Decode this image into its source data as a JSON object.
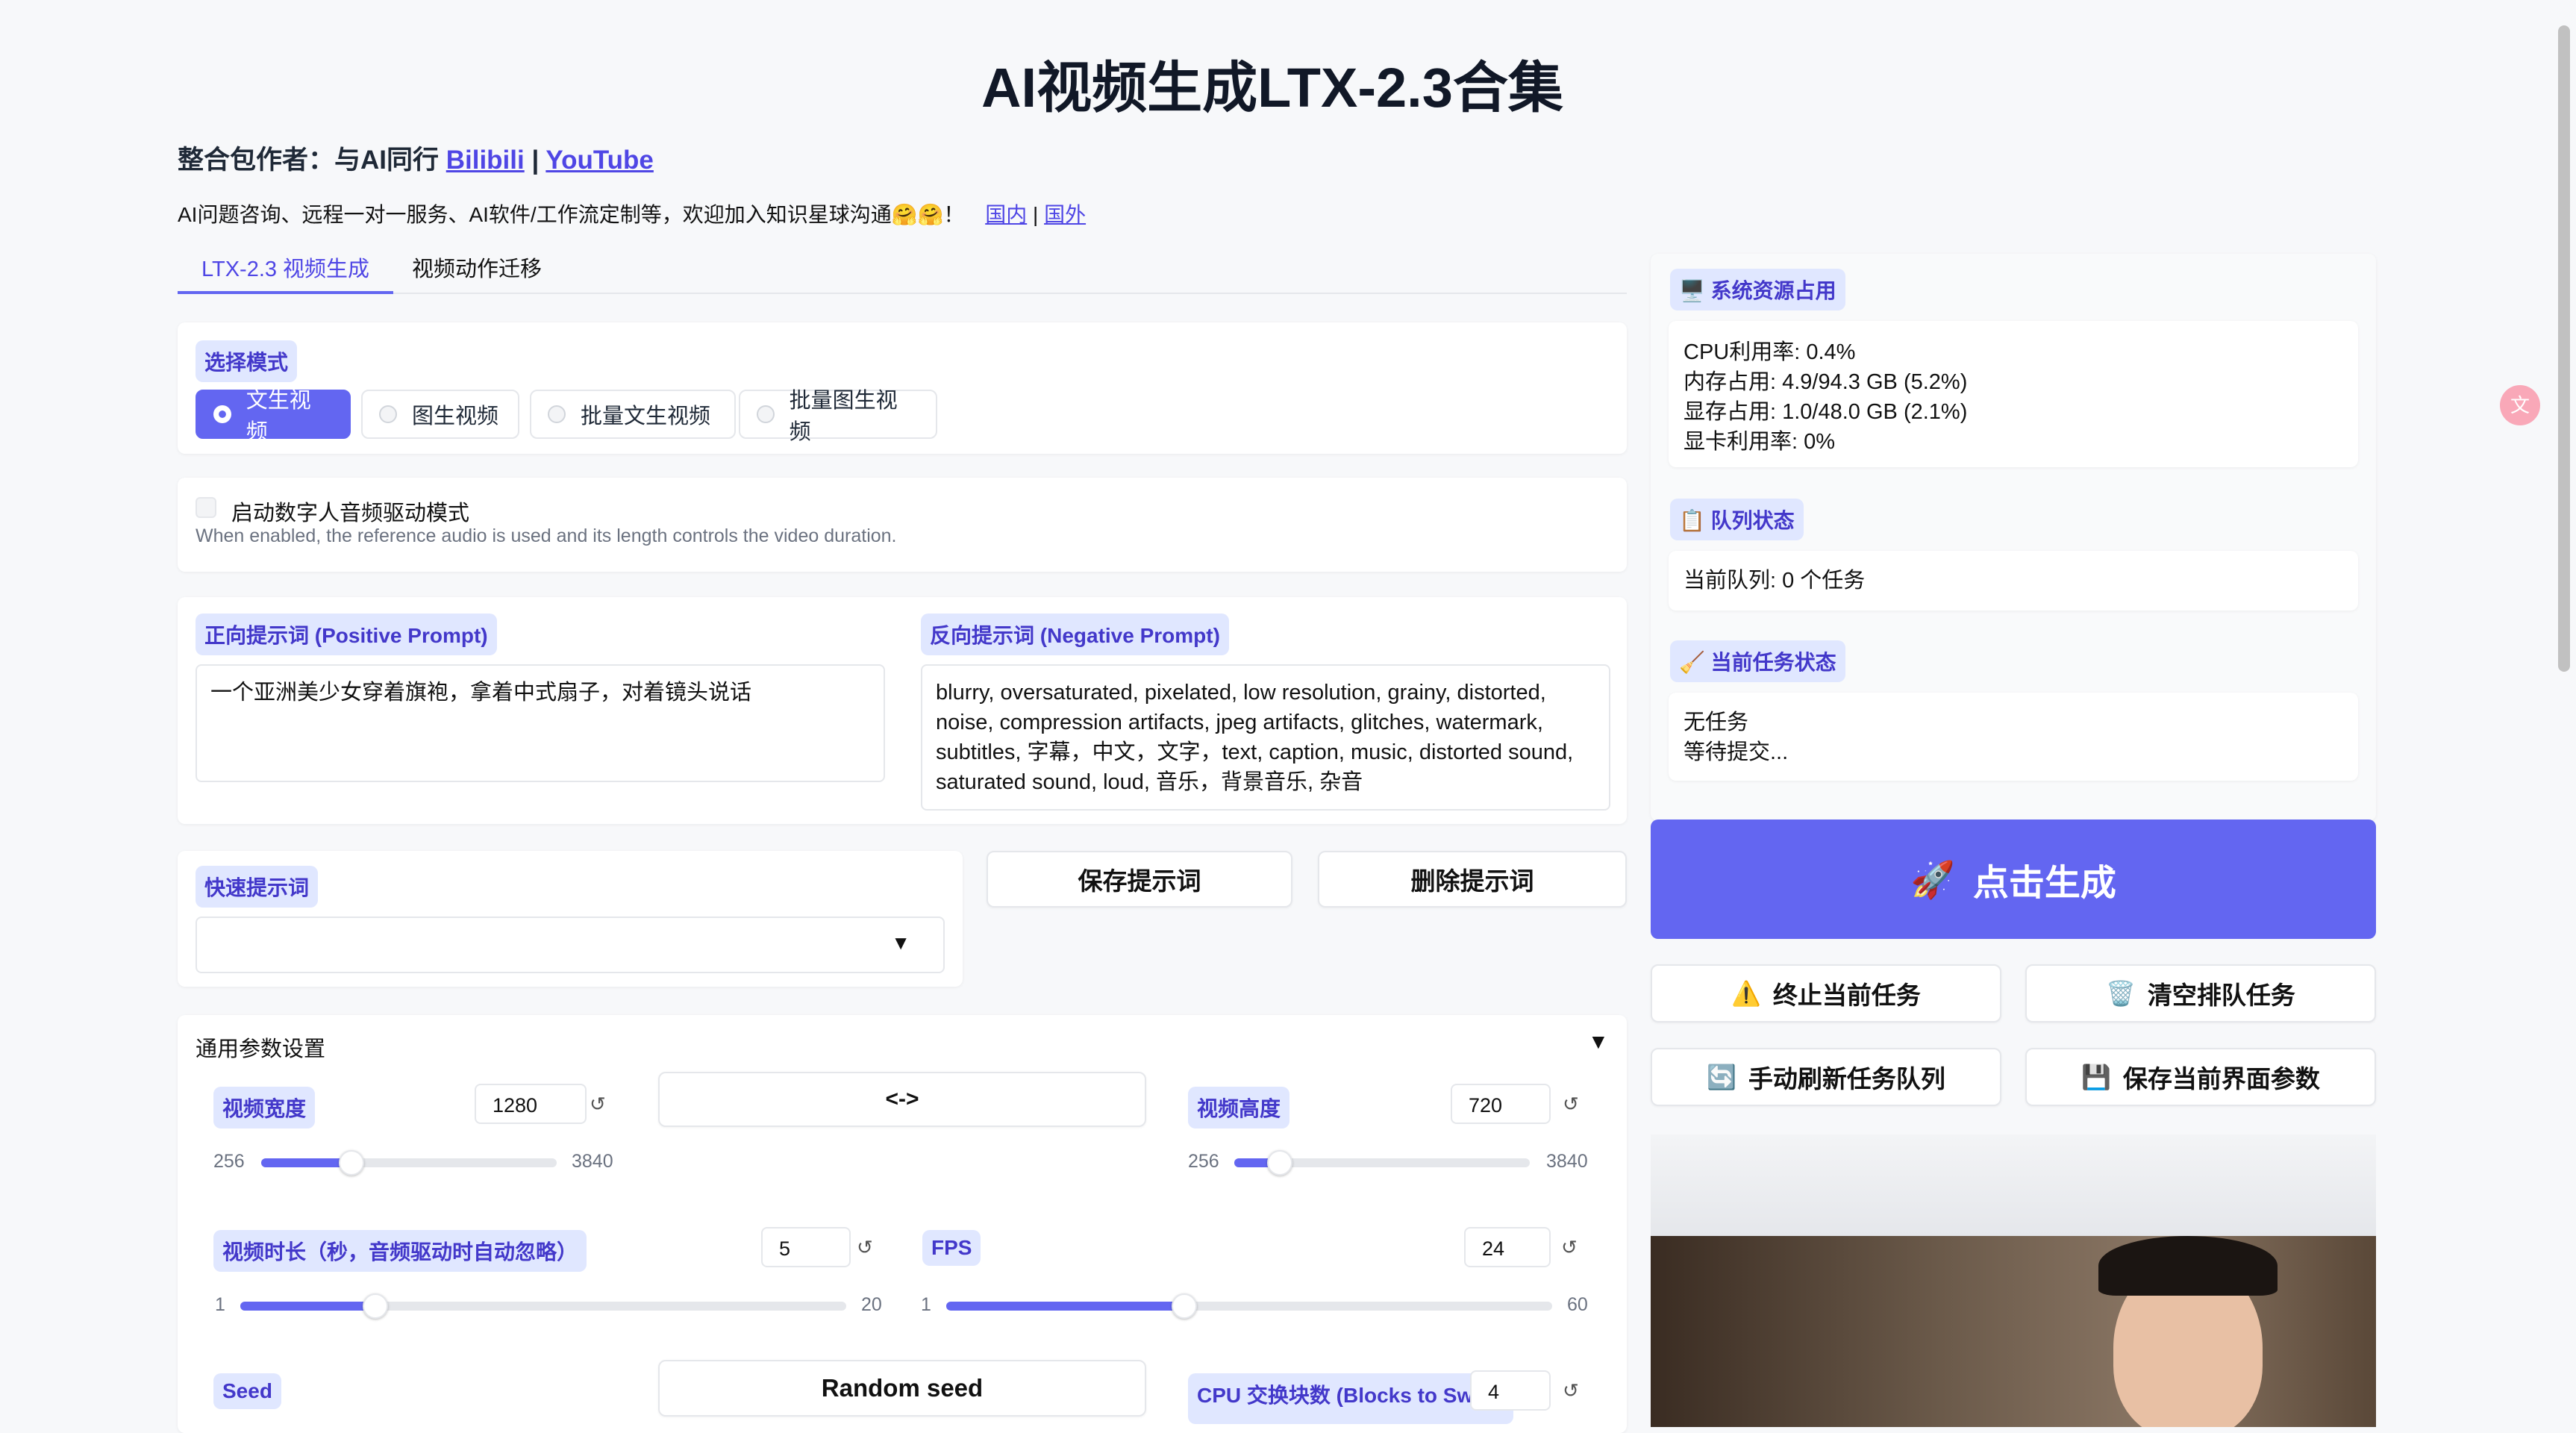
{
  "page": {
    "title": "AI视频生成LTX-2.3合集",
    "author_prefix": "整合包作者：与AI同行 ",
    "author_link_bilibili": "Bilibili",
    "author_sep": " | ",
    "author_link_youtube": "YouTube",
    "info_text": "AI问题咨询、远程一对一服务、AI软件/工作流定制等，欢迎加入知识星球沟通🤗🤗！",
    "info_link_domestic": "国内",
    "info_sep": " | ",
    "info_link_overseas": "国外"
  },
  "tabs": [
    {
      "label": "LTX-2.3 视频生成",
      "active": true
    },
    {
      "label": "视频动作迁移",
      "active": false
    }
  ],
  "mode": {
    "label": "选择模式",
    "options": [
      "文生视频",
      "图生视频",
      "批量文生视频",
      "批量图生视频"
    ],
    "selected": "文生视频"
  },
  "audio_driven": {
    "label": "启动数字人音频驱动模式",
    "hint": "When enabled, the reference audio is used and its length controls the video duration.",
    "checked": false
  },
  "prompts": {
    "positive_label": "正向提示词 (Positive Prompt)",
    "positive_value": "一个亚洲美少女穿着旗袍，拿着中式扇子，对着镜头说话",
    "negative_label": "反向提示词 (Negative Prompt)",
    "negative_value": "blurry, oversaturated, pixelated, low resolution, grainy, distorted, noise, compression artifacts, jpeg artifacts, glitches, watermark, subtitles, 字幕，中文，文字，text, caption, music, distorted sound, saturated sound, loud, 音乐，背景音乐, 杂音"
  },
  "quick_prompt": {
    "label": "快速提示词",
    "value": "",
    "save_label": "保存提示词",
    "delete_label": "删除提示词"
  },
  "params": {
    "section_label": "通用参数设置",
    "swap_label": "<->",
    "width": {
      "label": "视频宽度",
      "value": "1280",
      "min": "256",
      "max": "3840"
    },
    "height": {
      "label": "视频高度",
      "value": "720",
      "min": "256",
      "max": "3840"
    },
    "duration": {
      "label": "视频时长（秒，音频驱动时自动忽略）",
      "value": "5",
      "min": "1",
      "max": "20"
    },
    "fps": {
      "label": "FPS",
      "value": "24",
      "min": "1",
      "max": "60"
    },
    "seed": {
      "label": "Seed",
      "button": "Random seed"
    },
    "swap": {
      "label": "CPU 交换块数 (Blocks to Swap)",
      "value": "4"
    },
    "reset_glyph": "↺"
  },
  "status": {
    "system_label": "系统资源占用",
    "cpu": "CPU利用率: 0.4%",
    "mem": "内存占用: 4.9/94.3 GB (5.2%)",
    "vram": "显存占用: 1.0/48.0 GB (2.1%)",
    "gpu": "显卡利用率: 0%",
    "queue_label": "队列状态",
    "queue_value": "当前队列: 0 个任务",
    "task_label": "当前任务状态",
    "task_line1": "无任务",
    "task_line2": "等待提交..."
  },
  "actions": {
    "generate": "点击生成",
    "stop": "终止当前任务",
    "clear": "清空排队任务",
    "refresh": "手动刷新任务队列",
    "save_params": "保存当前界面参数"
  },
  "colors": {
    "accent": "#6366f1",
    "label_bg": "#e0e7ff",
    "label_text": "#4338ca"
  }
}
